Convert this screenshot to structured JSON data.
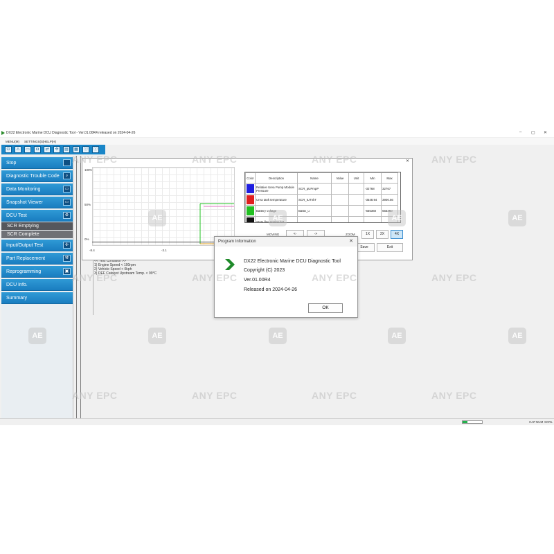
{
  "window": {
    "title": "DX22 Electronic Marine DCU Diagnostic Tool - Ver.01.00R4 released on 2024-04-26",
    "controls": [
      "–",
      "▢",
      "✕"
    ]
  },
  "menu": [
    "MENU(M)",
    "SETTINGS(S)",
    "HELP(H)"
  ],
  "toolbar": {
    "icons": [
      "power-icon",
      "warning-icon",
      "monitor-icon",
      "camera-icon",
      "io-icon",
      "move-icon",
      "dcu-icon",
      "report-icon",
      "info-circle-icon",
      "info-icon"
    ],
    "glyphs": [
      "⏻",
      "⚠",
      "▭",
      "◘",
      "⇄",
      "✣",
      "▤",
      "▦",
      "ⓘ",
      "ⓘ"
    ]
  },
  "sidebar": {
    "stop": "Stop",
    "items": [
      {
        "label": "Diagnostic Trouble Code",
        "icon": "dtc-icon",
        "glyph": "⌕"
      },
      {
        "label": "Data Monitoring",
        "icon": "monitor-icon",
        "glyph": "▭"
      },
      {
        "label": "Snapshot Viewer",
        "icon": "snapshot-icon",
        "glyph": "▭"
      },
      {
        "label": "DCU Test",
        "icon": "dcu-test-icon",
        "glyph": "⚙"
      }
    ],
    "subs": [
      "SCR Emptying",
      "SCR Complete"
    ],
    "items2": [
      {
        "label": "Input/Output Test",
        "icon": "io-test-icon",
        "glyph": "✣"
      },
      {
        "label": "Part Replacement",
        "icon": "part-icon",
        "glyph": "⚒"
      },
      {
        "label": "Reprogramming",
        "icon": "reprogram-icon",
        "glyph": "▣"
      },
      {
        "label": "DCU Info.",
        "icon": "",
        "glyph": ""
      },
      {
        "label": "Summary",
        "icon": "",
        "glyph": ""
      }
    ]
  },
  "graph": {
    "y_labels": [
      "100%",
      "50%",
      "0%"
    ],
    "x_labels": [
      "-8.4",
      "-3.1"
    ],
    "close": "✕",
    "moving_label": "MOVING",
    "zoom_label": "ZOOM",
    "nav_left": "<-",
    "nav_right": "->",
    "zoom": [
      "1X",
      "2X",
      "4X"
    ],
    "zoom_selected": "4X",
    "save": "Save",
    "exit": "Exit"
  },
  "param_table": {
    "headers": [
      "Color",
      "Description",
      "Name",
      "Value",
      "Unit",
      "Min",
      "Max"
    ],
    "rows": [
      {
        "color": "#1f1fe0",
        "description": "Relative Urea Pump Module Pressure",
        "name": "SCR_pUPmpP",
        "value": "",
        "unit": "",
        "min": "-32768",
        "max": "32767"
      },
      {
        "color": "#e01f1f",
        "description": "Urea tank temperature",
        "name": "SCR_tUTnkT",
        "value": "",
        "unit": "",
        "min": "-3548.94",
        "max": "3900.56"
      },
      {
        "color": "#21c021",
        "description": "Battery voltage",
        "name": "BattU_u",
        "value": "",
        "unit": "",
        "min": "-655360",
        "max": "655360"
      },
      {
        "color": "#111111",
        "description": "State flag engine hot",
        "name": "",
        "value": "",
        "unit": "",
        "min": "",
        "max": ""
      }
    ]
  },
  "test_condition": {
    "header": "<< Test Condition >>",
    "lines": [
      "1) Engine Speed < 100rpm",
      "2) Vehicle Speed < 0kph",
      "3) DEF Catalyst Upstream Temp. < 99°C"
    ]
  },
  "dialog": {
    "title": "Program Information",
    "close": "✕",
    "product": "DX22 Electronic Marine DCU Diagnostic Tool",
    "copyright": "Copyright (C) 2023",
    "version": "Ver.01.00R4",
    "released": "Released on 2024-04-26",
    "ok": "OK"
  },
  "statusbar": {
    "progress": 0.25,
    "indicators": [
      "CAP",
      "NUM",
      "SCRL"
    ]
  },
  "watermark": {
    "text": "ANY EPC",
    "badge": "AE"
  }
}
